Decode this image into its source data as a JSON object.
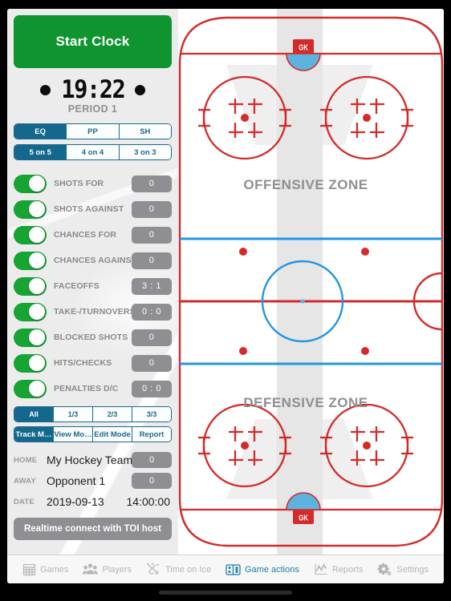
{
  "clock": {
    "start_button": "Start Clock",
    "time": "19:22",
    "period": "PERIOD 1",
    "accent_green": "#0f9430"
  },
  "strength_tabs": [
    {
      "label": "EQ",
      "active": true
    },
    {
      "label": "PP",
      "active": false
    },
    {
      "label": "SH",
      "active": false
    }
  ],
  "skaters_tabs": [
    {
      "label": "5 on 5",
      "active": true
    },
    {
      "label": "4 on 4",
      "active": false
    },
    {
      "label": "3 on 3",
      "active": false
    }
  ],
  "stats": [
    {
      "label": "SHOTS FOR",
      "value": "0",
      "on": true
    },
    {
      "label": "SHOTS AGAINST",
      "value": "0",
      "on": true
    },
    {
      "label": "CHANCES FOR",
      "value": "0",
      "on": true
    },
    {
      "label": "CHANCES AGAINST",
      "value": "0",
      "on": true
    },
    {
      "label": "FACEOFFS",
      "value": "3 : 1",
      "on": true
    },
    {
      "label": "TAKE-/TURNOVERS",
      "value": "0 : 0",
      "on": true
    },
    {
      "label": "BLOCKED SHOTS",
      "value": "0",
      "on": true
    },
    {
      "label": "HITS/CHECKS",
      "value": "0",
      "on": true
    },
    {
      "label": "PENALTIES D/C",
      "value": "0 : 0",
      "on": true
    }
  ],
  "period_filter": [
    {
      "label": "All",
      "active": true
    },
    {
      "label": "1/3",
      "active": false
    },
    {
      "label": "2/3",
      "active": false
    },
    {
      "label": "3/3",
      "active": false
    }
  ],
  "modes": [
    {
      "label": "Track M…",
      "active": true
    },
    {
      "label": "View Mo…",
      "active": false
    },
    {
      "label": "Edit Mode",
      "active": false
    },
    {
      "label": "Report",
      "active": false
    }
  ],
  "game_info": {
    "home_key": "HOME",
    "home_team": "My Hockey Team",
    "home_score": "0",
    "away_key": "AWAY",
    "away_team": "Opponent 1",
    "away_score": "0",
    "date_key": "DATE",
    "date": "2019-09-13",
    "time": "14:00:00"
  },
  "realtime_button": "Realtime connect with TOI host",
  "rink": {
    "offensive_zone_label": "OFFENSIVE ZONE",
    "defensive_zone_label": "DEFENSIVE ZONE",
    "goalie_label_top": "GK",
    "goalie_label_bottom": "GK",
    "line_red": "#d42a2a",
    "line_blue": "#2196e3",
    "crease_blue": "#5cb3de",
    "ice_white": "#ffffff"
  },
  "tabbar": [
    {
      "label": "Games",
      "icon": "calendar-icon",
      "active": false
    },
    {
      "label": "Players",
      "icon": "players-icon",
      "active": false
    },
    {
      "label": "Time on Ice",
      "icon": "time-on-ice-icon",
      "active": false
    },
    {
      "label": "Game actions",
      "icon": "game-actions-icon",
      "active": true
    },
    {
      "label": "Reports",
      "icon": "chart-icon",
      "active": false
    },
    {
      "label": "Settings",
      "icon": "gear-icon",
      "active": false
    }
  ]
}
